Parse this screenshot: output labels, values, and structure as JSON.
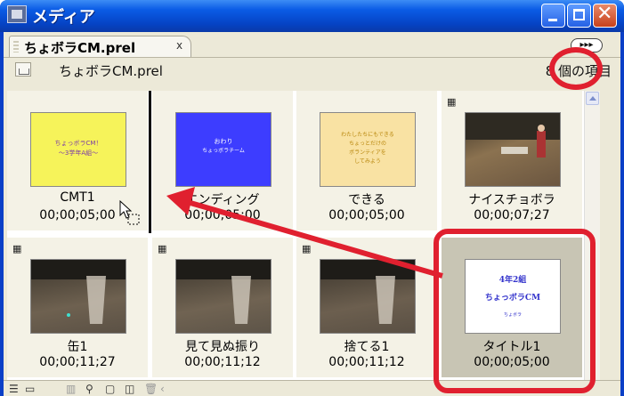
{
  "window": {
    "title": "メディア"
  },
  "tab": {
    "label": "ちょボラCM.prel",
    "close": "x"
  },
  "panel_menu": {
    "label": "▸▸▸"
  },
  "infobar": {
    "project_name": "ちょボラCM.prel",
    "item_count": "8 個の項目"
  },
  "items": [
    {
      "name": "CMT1",
      "duration": "00;00;05;00",
      "kind": "title",
      "thumb_bg": "#f6f35a",
      "thumb_text": "ちょっボラCM！\n～3学年A組～"
    },
    {
      "name": "エンディング",
      "duration": "00;00;05;00",
      "kind": "title",
      "thumb_bg": "#3d3dff",
      "thumb_text": "おわり\nちょっボラチーム"
    },
    {
      "name": "できる",
      "duration": "00;00;05;00",
      "kind": "title",
      "thumb_bg": "#f9e2a3",
      "thumb_text": "わたしたちにもできる\nちょっとだけの\nボランティアをしてみよう"
    },
    {
      "name": "ナイスチョボラ",
      "duration": "00;00;07;27",
      "kind": "video",
      "thumb_bg": "#6b5640"
    },
    {
      "name": "缶1",
      "duration": "00;00;11;27",
      "kind": "video",
      "thumb_bg": "#5b5145"
    },
    {
      "name": "見て見ぬ振り",
      "duration": "00;00;11;12",
      "kind": "video",
      "thumb_bg": "#5d5448"
    },
    {
      "name": "捨てる1",
      "duration": "00;00;11;12",
      "kind": "video",
      "thumb_bg": "#5a5044"
    },
    {
      "name": "タイトル1",
      "duration": "00;00;05;00",
      "kind": "title",
      "thumb_bg": "#ffffff",
      "thumb_text": "4年2組\nちょっボラCM\nちょボラ"
    }
  ],
  "colors": {
    "annotation": "#e0202f",
    "titlebar": "#0b5ce6",
    "panel": "#ece9d8"
  }
}
